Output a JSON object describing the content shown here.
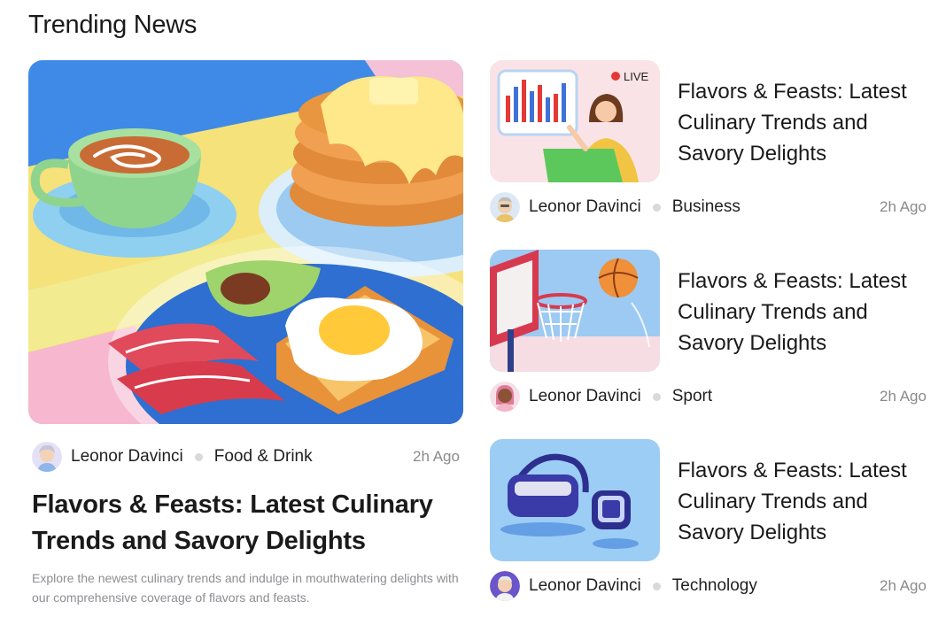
{
  "section": {
    "title": "Trending News"
  },
  "featured": {
    "author": "Leonor Davinci",
    "category": "Food & Drink",
    "time": "2h Ago",
    "headline": "Flavors & Feasts: Latest Culinary Trends and Savory Delights",
    "description": "Explore the newest culinary trends and indulge in mouthwatering delights with our comprehensive coverage of flavors and feasts.",
    "image_icon": "breakfast-illustration"
  },
  "cards": [
    {
      "title": "Flavors & Feasts: Latest Culinary Trends and Savory Delights",
      "author": "Leonor Davinci",
      "category": "Business",
      "time": "2h Ago",
      "badge": "LIVE",
      "image_icon": "presentation-illustration"
    },
    {
      "title": "Flavors & Feasts: Latest Culinary Trends and Savory Delights",
      "author": "Leonor Davinci",
      "category": "Sport",
      "time": "2h Ago",
      "image_icon": "basketball-illustration"
    },
    {
      "title": "Flavors & Feasts: Latest Culinary Trends and Savory Delights",
      "author": "Leonor Davinci",
      "category": "Technology",
      "time": "2h Ago",
      "image_icon": "vr-headset-illustration"
    }
  ],
  "colors": {
    "meta_dot": "#d9d9dc",
    "muted_text": "#8a8a8e",
    "live_red": "#e53935"
  }
}
